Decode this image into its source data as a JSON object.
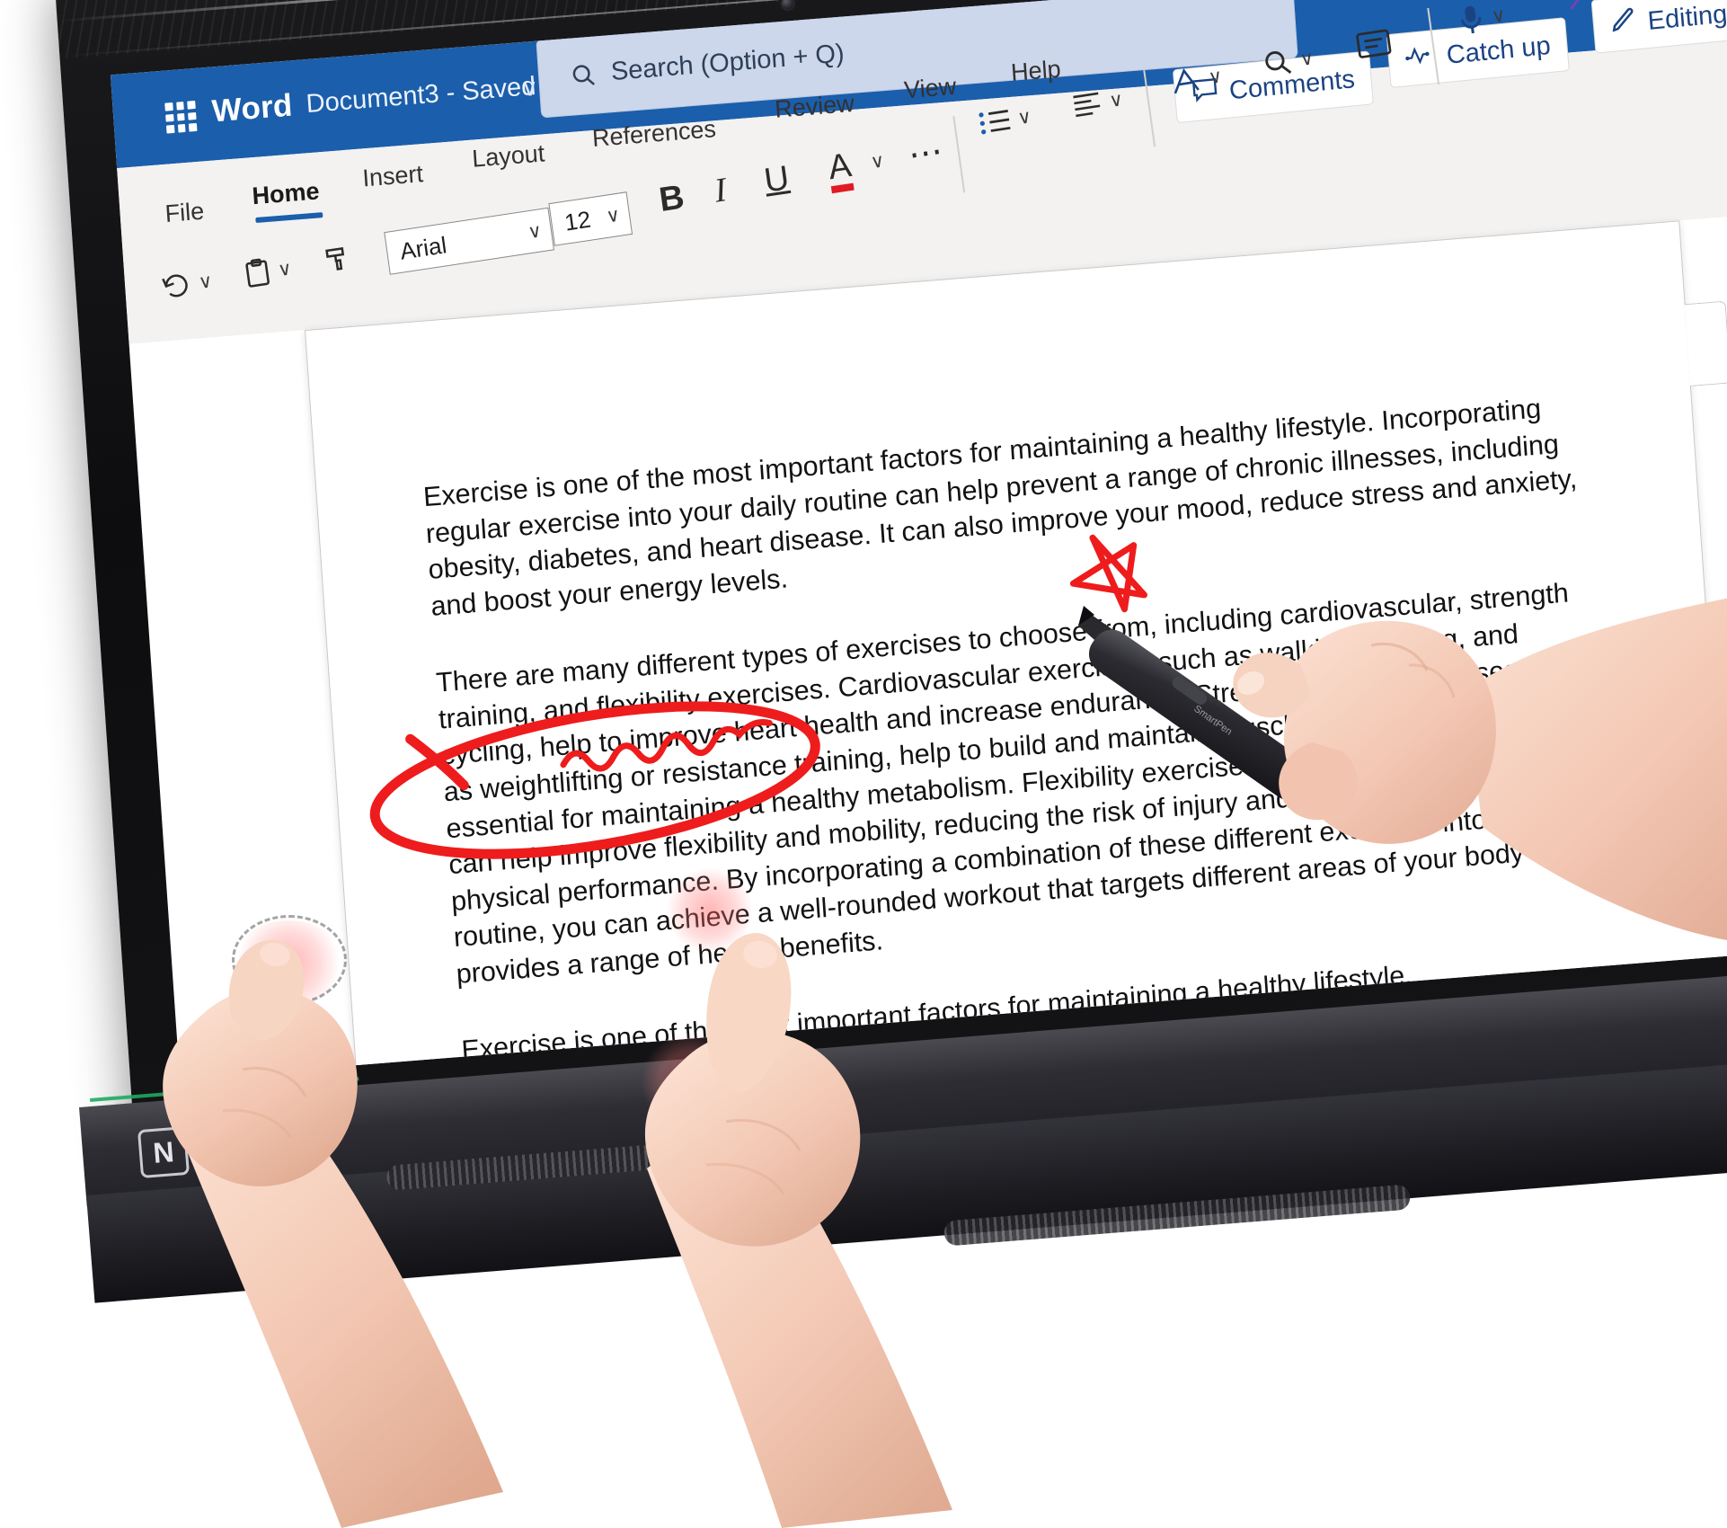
{
  "app": {
    "name": "Word",
    "document_title": "Document3  -  Saved",
    "title_chevron_icon": "chevron-down-icon",
    "waffle_icon": "app-launcher-waffle-icon"
  },
  "search": {
    "placeholder": "Search (Option + Q)",
    "icon": "search-icon"
  },
  "title_actions": [
    {
      "label": "Comments",
      "icon": "comment-bubble-icon"
    },
    {
      "label": "Catch up",
      "icon": "activity-pulse-icon"
    },
    {
      "label": "Editing",
      "icon": "pencil-icon",
      "chevron": "chevron-down-icon"
    }
  ],
  "tabs": [
    {
      "label": "File",
      "active": false
    },
    {
      "label": "Home",
      "active": true
    },
    {
      "label": "Insert",
      "active": false
    },
    {
      "label": "Layout",
      "active": false
    },
    {
      "label": "References",
      "active": false
    },
    {
      "label": "Review",
      "active": false
    },
    {
      "label": "View",
      "active": false
    },
    {
      "label": "Help",
      "active": false
    }
  ],
  "toolbar": {
    "undo": {
      "icon": "undo-arrow-icon",
      "chevron": "chevron-down-icon"
    },
    "paste": {
      "icon": "clipboard-paste-icon",
      "chevron": "chevron-down-icon"
    },
    "format_painter": {
      "icon": "format-painter-brush-icon"
    },
    "font_name": "Arial",
    "font_name_chevron": "chevron-down-icon",
    "font_size": "12",
    "font_size_chevron": "chevron-down-icon",
    "bold": {
      "label": "B",
      "icon": "bold-icon"
    },
    "italic": {
      "label": "I",
      "icon": "italic-icon"
    },
    "underline": {
      "label": "U",
      "icon": "underline-icon"
    },
    "font_color": {
      "label": "A",
      "icon": "font-color-icon",
      "color": "#e01b24",
      "chevron": "chevron-down-icon"
    },
    "more_formatting": {
      "icon": "ellipsis-icon"
    },
    "bullets": {
      "icon": "bulleted-list-icon",
      "chevron": "chevron-down-icon"
    },
    "align": {
      "icon": "align-left-icon",
      "chevron": "chevron-down-icon"
    },
    "styles": {
      "icon": "styles-pen-icon",
      "chevron": "chevron-down-icon"
    },
    "find": {
      "icon": "magnifier-icon",
      "chevron": "chevron-down-icon"
    },
    "immersive_reader": {
      "icon": "immersive-reader-icon"
    },
    "dictate": {
      "icon": "microphone-icon",
      "chevron": "chevron-down-icon"
    },
    "editor": {
      "icon": "magic-wand-icon",
      "chevron": "chevron-down-icon"
    }
  },
  "document": {
    "paragraphs": [
      "Exercise is one of the most important factors for maintaining a healthy lifestyle. Incorporating regular exercise into your daily routine can help prevent a range of chronic illnesses, including obesity, diabetes, and heart disease. It can also improve your mood, reduce stress and anxiety, and boost your energy levels.",
      "There are many different types of exercises to choose from, including cardiovascular, strength training, and flexibility exercises. Cardiovascular exercises, such as walking, running, and cycling, help to improve heart health and increase endurance. Strength training exercises, such as weightlifting or resistance training, help to build and maintain muscle mass, which is essential for maintaining a healthy metabolism. Flexibility exercises, such as stretching or yoga, can help improve flexibility and mobility, reducing the risk of injury and improving overall physical performance. By incorporating a combination of these different exercises into your routine, you can achieve a well-rounded workout that targets different areas of your body and provides a range of health benefits.",
      "Exercise is one of the most important factors for maintaining a healthy lifestyle."
    ]
  },
  "annotations": {
    "ink_color": "#ee1c1c",
    "marks": [
      {
        "type": "squiggle-underline",
        "over_text": "reduce stress and anxiety,"
      },
      {
        "type": "star",
        "near": "end of first paragraph"
      },
      {
        "type": "ellipse-circle",
        "over_text": "There are many different types of exercises to choose from, including cardiovascular, strength training"
      }
    ]
  },
  "hardware": {
    "stylus_label": "SmartPen",
    "nfc_label": "N",
    "touch_points": 2
  },
  "colors": {
    "word_blue": "#1b5eab",
    "ribbon_bg": "#f3f2f1",
    "ink_red": "#ee1c1c",
    "accent_text": "#1b4383"
  }
}
